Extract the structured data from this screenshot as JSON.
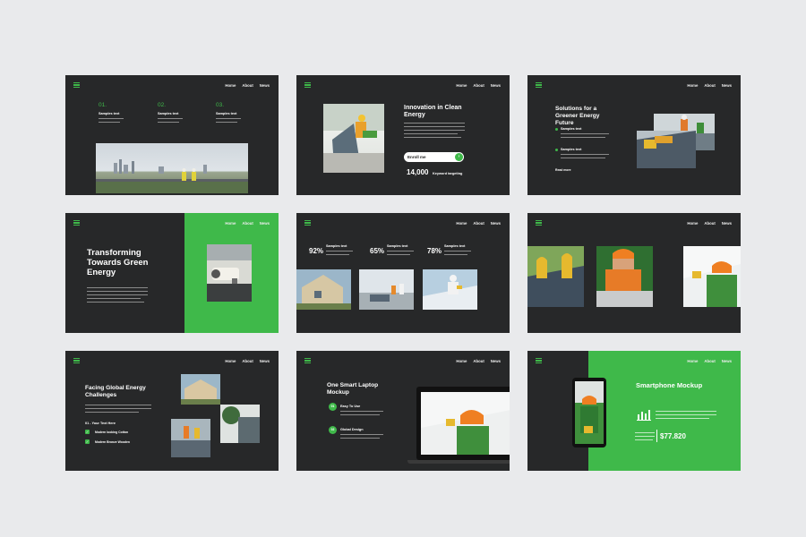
{
  "nav": {
    "home": "Home",
    "about": "About",
    "news": "News"
  },
  "slide1": {
    "cols": [
      {
        "num": "01.",
        "label": "Samples text"
      },
      {
        "num": "02.",
        "label": "Samples text"
      },
      {
        "num": "03.",
        "label": "Samples text"
      }
    ]
  },
  "slide2": {
    "title": "Innovation in Clean Energy",
    "button": "Enroll me",
    "stat_value": "14,000",
    "stat_label": "Keyword targeting"
  },
  "slide3": {
    "title": "Solutions for a Greener Energy Future",
    "bullet1": "Samples text",
    "bullet2": "Samples text",
    "link": "Read more"
  },
  "slide4": {
    "title": "Transforming Towards Green Energy"
  },
  "slide5": {
    "stats": [
      {
        "pct": "92%",
        "label": "Samples text"
      },
      {
        "pct": "65%",
        "label": "Samples text"
      },
      {
        "pct": "78%",
        "label": "Samples text"
      }
    ]
  },
  "slide7": {
    "title": "Facing Global Energy Challenges",
    "subhead": "01 - Your Text Here",
    "items": [
      "Modern looking Cotton",
      "Modern Bronze Wooden"
    ]
  },
  "slide8": {
    "title": "One Smart Laptop Mockup",
    "features": [
      {
        "badge": "01",
        "label": "Easy To Use"
      },
      {
        "badge": "02",
        "label": "Global Design"
      }
    ]
  },
  "slide9": {
    "title": "Smartphone Mockup",
    "value": "$77.820"
  },
  "colors": {
    "accent": "#3fb94a",
    "slide_bg": "#272829",
    "page_bg": "#e9eaec"
  }
}
